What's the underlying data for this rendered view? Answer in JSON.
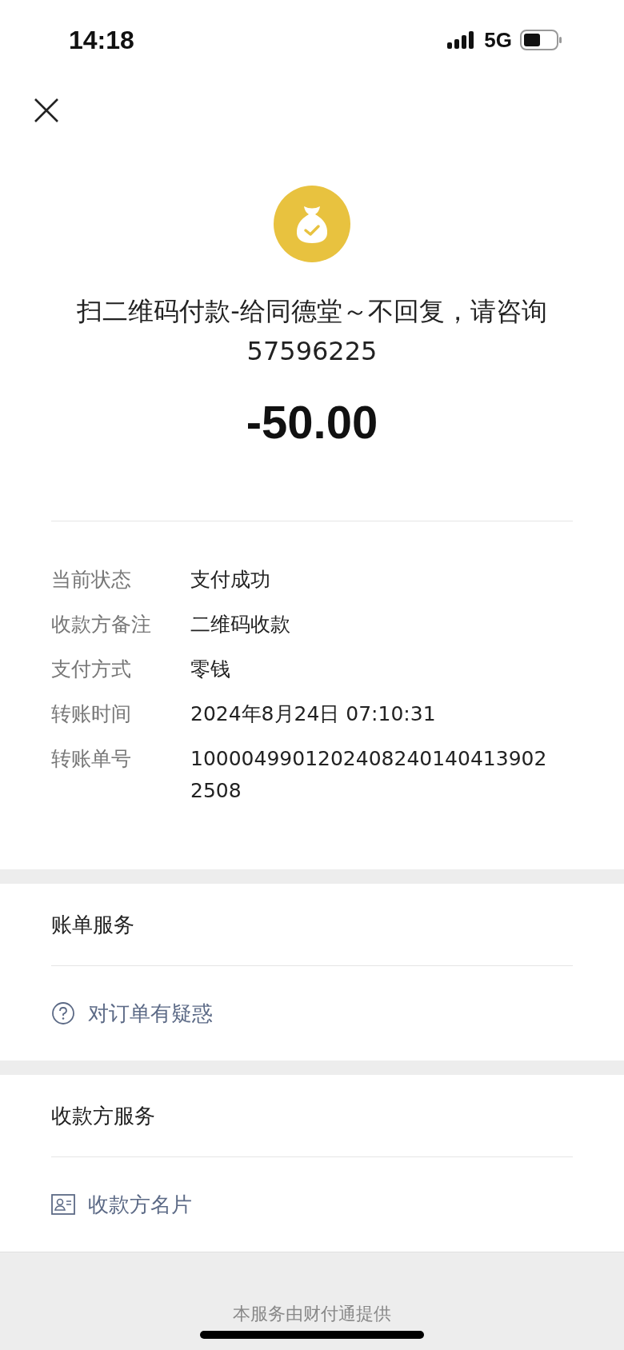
{
  "status_bar": {
    "time": "14:18",
    "network": "5G"
  },
  "header": {
    "title": "扫二维码付款-给同德堂～不回复，请咨询57596225",
    "amount": "-50.00"
  },
  "details": [
    {
      "label": "当前状态",
      "value": "支付成功"
    },
    {
      "label": "收款方备注",
      "value": "二维码收款"
    },
    {
      "label": "支付方式",
      "value": "零钱"
    },
    {
      "label": "转账时间",
      "value": "2024年8月24日 07:10:31"
    },
    {
      "label": "转账单号",
      "value_lines": [
        "1000049901202408240140413902",
        "2508"
      ]
    }
  ],
  "sections": [
    {
      "title": "账单服务",
      "link": {
        "kind": "help",
        "label": "对订单有疑惑"
      }
    },
    {
      "title": "收款方服务",
      "link": {
        "kind": "card",
        "label": "收款方名片"
      }
    }
  ],
  "footer": "本服务由财付通提供"
}
